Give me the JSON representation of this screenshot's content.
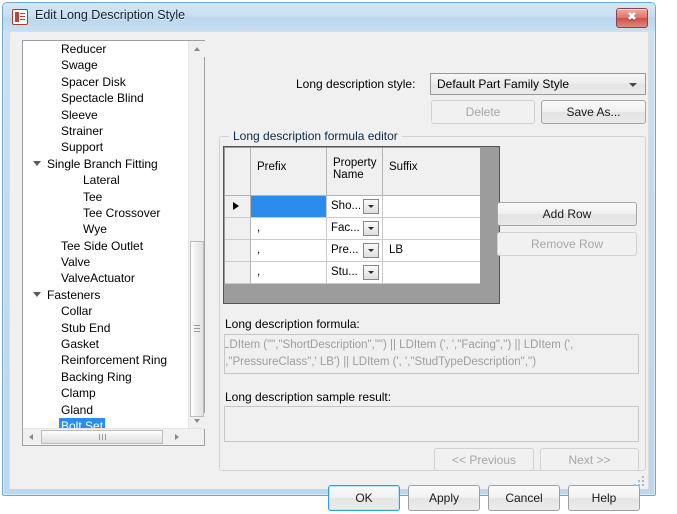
{
  "window": {
    "title": "Edit Long Description Style",
    "icon": "form-icon",
    "close_label": "✖"
  },
  "tree": {
    "items": [
      {
        "label": "Reducer",
        "level": 1,
        "expander": false,
        "selected": false
      },
      {
        "label": "Swage",
        "level": 1,
        "expander": false,
        "selected": false
      },
      {
        "label": "Spacer Disk",
        "level": 1,
        "expander": false,
        "selected": false
      },
      {
        "label": "Spectacle Blind",
        "level": 1,
        "expander": false,
        "selected": false
      },
      {
        "label": "Sleeve",
        "level": 1,
        "expander": false,
        "selected": false
      },
      {
        "label": "Strainer",
        "level": 1,
        "expander": false,
        "selected": false
      },
      {
        "label": "Support",
        "level": 1,
        "expander": false,
        "selected": false
      },
      {
        "label": "Single Branch Fitting",
        "level": 0,
        "expander": true,
        "selected": false
      },
      {
        "label": "Lateral",
        "level": 2,
        "expander": false,
        "selected": false
      },
      {
        "label": "Tee",
        "level": 2,
        "expander": false,
        "selected": false
      },
      {
        "label": "Tee Crossover",
        "level": 2,
        "expander": false,
        "selected": false
      },
      {
        "label": "Wye",
        "level": 2,
        "expander": false,
        "selected": false
      },
      {
        "label": "Tee Side Outlet",
        "level": 1,
        "expander": false,
        "selected": false
      },
      {
        "label": "Valve",
        "level": 1,
        "expander": false,
        "selected": false
      },
      {
        "label": "ValveActuator",
        "level": 1,
        "expander": false,
        "selected": false
      },
      {
        "label": "Fasteners",
        "level": 0,
        "expander": true,
        "selected": false
      },
      {
        "label": "Collar",
        "level": 1,
        "expander": false,
        "selected": false
      },
      {
        "label": "Stub End",
        "level": 1,
        "expander": false,
        "selected": false
      },
      {
        "label": "Gasket",
        "level": 1,
        "expander": false,
        "selected": false
      },
      {
        "label": "Reinforcement Ring",
        "level": 1,
        "expander": false,
        "selected": false
      },
      {
        "label": "Backing Ring",
        "level": 1,
        "expander": false,
        "selected": false
      },
      {
        "label": "Clamp",
        "level": 1,
        "expander": false,
        "selected": false
      },
      {
        "label": "Gland",
        "level": 1,
        "expander": false,
        "selected": false
      },
      {
        "label": "Bolt Set",
        "level": 1,
        "expander": false,
        "selected": true
      }
    ],
    "selected_label": "Bolt Set",
    "selection_color": "#2a8dec"
  },
  "style_section": {
    "label": "Long description style:",
    "combo_value": "Default Part Family Style",
    "combo_icon": "chevron-down-icon",
    "delete_label": "Delete",
    "delete_enabled": false,
    "save_as_label": "Save As...",
    "save_as_enabled": true
  },
  "formula_editor": {
    "group_title": "Long description formula editor",
    "columns": [
      "",
      "Prefix",
      "Property Name",
      "Suffix"
    ],
    "rows": [
      {
        "marker": true,
        "prefix": "",
        "property": "Sho...",
        "suffix": "",
        "prefix_selected": true
      },
      {
        "marker": false,
        "prefix": ",",
        "property": "Fac...",
        "suffix": "",
        "prefix_selected": false
      },
      {
        "marker": false,
        "prefix": ",",
        "property": "Pre...",
        "suffix": "LB",
        "prefix_selected": false
      },
      {
        "marker": false,
        "prefix": ",",
        "property": "Stu...",
        "suffix": "",
        "prefix_selected": false
      }
    ],
    "add_row_label": "Add Row",
    "add_row_enabled": true,
    "remove_row_label": "Remove Row",
    "remove_row_enabled": false
  },
  "formula": {
    "label": "Long description formula:",
    "text": "LDItem (\"\",\"ShortDescription\",\"\") || LDItem (', ',\"Facing\",'') || LDItem (', ',\"PressureClass\",' LB') || LDItem (', ',\"StudTypeDescription\",'')"
  },
  "sample_result": {
    "label": "Long description sample result:",
    "text": ""
  },
  "navigation": {
    "previous_label": "<< Previous",
    "previous_enabled": false,
    "next_label": "Next >>",
    "next_enabled": false
  },
  "footer": {
    "ok_label": "OK",
    "apply_label": "Apply",
    "cancel_label": "Cancel",
    "help_label": "Help"
  },
  "colors": {
    "title_bar": "#c9def2",
    "dialog_bg": "#f0f0f0",
    "selection": "#2a8dec",
    "close_button": "#cf4f46",
    "default_button_focus": "#2f9fd6"
  }
}
